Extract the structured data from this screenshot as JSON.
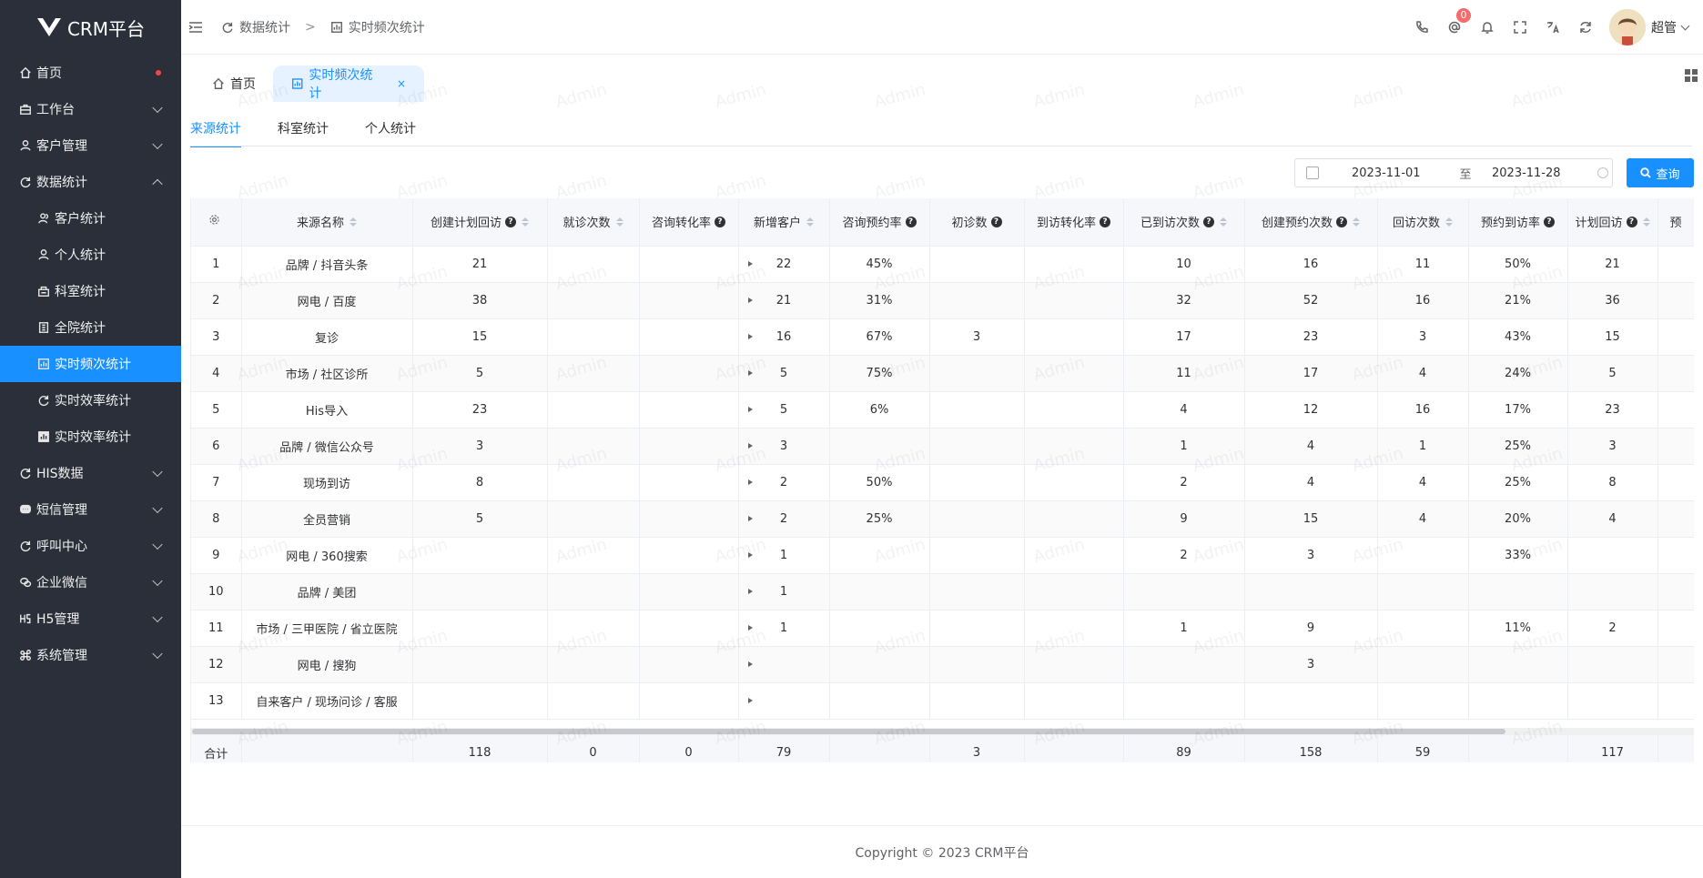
{
  "app": {
    "name": "CRM平台"
  },
  "sidebar": {
    "items": [
      {
        "label": "首页",
        "icon": "home-icon",
        "level": 0,
        "chevron": "none",
        "dot": true
      },
      {
        "label": "工作台",
        "icon": "briefcase-icon",
        "level": 0,
        "chevron": "down"
      },
      {
        "label": "客户管理",
        "icon": "user-icon",
        "level": 0,
        "chevron": "down"
      },
      {
        "label": "数据统计",
        "icon": "refresh-icon",
        "level": 0,
        "chevron": "up"
      },
      {
        "label": "客户统计",
        "icon": "users-icon",
        "level": 1
      },
      {
        "label": "个人统计",
        "icon": "user-icon",
        "level": 1
      },
      {
        "label": "科室统计",
        "icon": "department-icon",
        "level": 1
      },
      {
        "label": "全院统计",
        "icon": "building-icon",
        "level": 1
      },
      {
        "label": "实时频次统计",
        "icon": "chart-icon",
        "level": 1,
        "active": true
      },
      {
        "label": "实时效率统计",
        "icon": "refresh-icon",
        "level": 1
      },
      {
        "label": "实时效率统计",
        "icon": "bar-chart-icon",
        "level": 1
      },
      {
        "label": "HIS数据",
        "icon": "refresh-icon",
        "level": 0,
        "chevron": "down"
      },
      {
        "label": "短信管理",
        "icon": "message-icon",
        "level": 0,
        "chevron": "down"
      },
      {
        "label": "呼叫中心",
        "icon": "refresh-icon",
        "level": 0,
        "chevron": "down"
      },
      {
        "label": "企业微信",
        "icon": "wechat-icon",
        "level": 0,
        "chevron": "down"
      },
      {
        "label": "H5管理",
        "icon": "h5-icon",
        "level": 0,
        "chevron": "down"
      },
      {
        "label": "系统管理",
        "icon": "command-icon",
        "level": 0,
        "chevron": "down"
      }
    ]
  },
  "header": {
    "breadcrumb": [
      "数据统计",
      "实时频次统计"
    ],
    "breadcrumb_sep": ">",
    "notification_count": "0",
    "user_name": "超管"
  },
  "tabs": {
    "home": "首页",
    "current": "实时频次统计",
    "close": "×"
  },
  "subtabs": [
    "来源统计",
    "科室统计",
    "个人统计"
  ],
  "filter": {
    "start_date": "2023-11-01",
    "to": "至",
    "end_date": "2023-11-28",
    "query": "查询"
  },
  "table": {
    "columns": [
      {
        "label": "",
        "icon": "gear-icon"
      },
      {
        "label": "来源名称",
        "sort": true
      },
      {
        "label": "创建计划回访",
        "help": true,
        "sort": true
      },
      {
        "label": "就诊次数",
        "sort": true
      },
      {
        "label": "咨询转化率",
        "help": true
      },
      {
        "label": "新增客户",
        "sort": true
      },
      {
        "label": "咨询预约率",
        "help": true
      },
      {
        "label": "初诊数",
        "help": true
      },
      {
        "label": "到访转化率",
        "help": true
      },
      {
        "label": "已到访次数",
        "help": true,
        "sort": true
      },
      {
        "label": "创建预约次数",
        "help": true,
        "sort": true
      },
      {
        "label": "回访次数",
        "sort": true
      },
      {
        "label": "预约到访率",
        "help": true
      },
      {
        "label": "计划回访",
        "help": true,
        "sort": true
      },
      {
        "label": "预"
      }
    ],
    "rows": [
      [
        "1",
        "品牌 / 抖音头条",
        "21",
        "",
        "",
        "22",
        "45%",
        "",
        "",
        "10",
        "16",
        "11",
        "50%",
        "21",
        ""
      ],
      [
        "2",
        "网电 / 百度",
        "38",
        "",
        "",
        "21",
        "31%",
        "",
        "",
        "32",
        "52",
        "16",
        "21%",
        "36",
        ""
      ],
      [
        "3",
        "复诊",
        "15",
        "",
        "",
        "16",
        "67%",
        "3",
        "",
        "17",
        "23",
        "3",
        "43%",
        "15",
        ""
      ],
      [
        "4",
        "市场 / 社区诊所",
        "5",
        "",
        "",
        "5",
        "75%",
        "",
        "",
        "11",
        "17",
        "4",
        "24%",
        "5",
        ""
      ],
      [
        "5",
        "His导入",
        "23",
        "",
        "",
        "5",
        "6%",
        "",
        "",
        "4",
        "12",
        "16",
        "17%",
        "23",
        ""
      ],
      [
        "6",
        "品牌 / 微信公众号",
        "3",
        "",
        "",
        "3",
        "",
        "",
        "",
        "1",
        "4",
        "1",
        "25%",
        "3",
        ""
      ],
      [
        "7",
        "现场到访",
        "8",
        "",
        "",
        "2",
        "50%",
        "",
        "",
        "2",
        "4",
        "4",
        "25%",
        "8",
        ""
      ],
      [
        "8",
        "全员营销",
        "5",
        "",
        "",
        "2",
        "25%",
        "",
        "",
        "9",
        "15",
        "4",
        "20%",
        "4",
        ""
      ],
      [
        "9",
        "网电 / 360搜索",
        "",
        "",
        "",
        "1",
        "",
        "",
        "",
        "2",
        "3",
        "",
        "33%",
        "",
        ""
      ],
      [
        "10",
        "品牌 / 美团",
        "",
        "",
        "",
        "1",
        "",
        "",
        "",
        "",
        "",
        "",
        "",
        "",
        ""
      ],
      [
        "11",
        "市场 / 三甲医院 / 省立医院",
        "",
        "",
        "",
        "1",
        "",
        "",
        "",
        "1",
        "9",
        "",
        "11%",
        "2",
        ""
      ],
      [
        "12",
        "网电 / 搜狗",
        "",
        "",
        "",
        "",
        "",
        "",
        "",
        "",
        "3",
        "",
        "",
        "",
        ""
      ],
      [
        "13",
        "自来客户 / 现场问诊 / 客服",
        "",
        "",
        "",
        "",
        "",
        "",
        "",
        "",
        "",
        "",
        "",
        "",
        ""
      ]
    ],
    "summary": [
      "合计",
      "",
      "118",
      "0",
      "0",
      "79",
      "",
      "3",
      "",
      "89",
      "158",
      "59",
      "",
      "117",
      ""
    ]
  },
  "footer": {
    "text": "Copyright © 2023 CRM平台"
  },
  "watermark": "Admin",
  "colors": {
    "sidebar_bg": "#2b2f3a",
    "accent": "#1890ff",
    "badge": "#f56c6c"
  }
}
